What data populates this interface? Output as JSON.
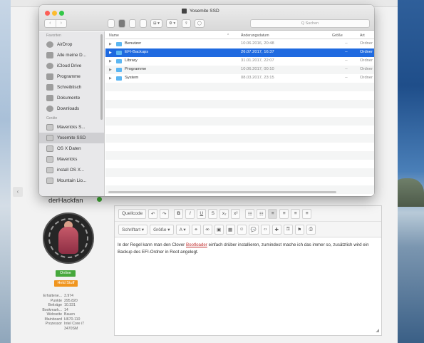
{
  "finder": {
    "title": "Yosemite SSD",
    "search_placeholder": "Q Suchen",
    "nav_back": "‹",
    "nav_forward": "›",
    "arrange_label": "⊞ ▾",
    "action_label": "⚙ ▾",
    "share_label": "⇪",
    "tag_label": "◯",
    "columns": {
      "name": "Name",
      "date": "Änderungsdatum",
      "size": "Größe",
      "kind": "Art"
    },
    "rows": [
      {
        "name": "Benutzer",
        "date": "10.06.2016, 20:48",
        "size": "--",
        "kind": "Ordner"
      },
      {
        "name": "EFI-Backups",
        "date": "26.07.2017, 16:37",
        "size": "--",
        "kind": "Ordner"
      },
      {
        "name": "Library",
        "date": "31.01.2017, 22:07",
        "size": "--",
        "kind": "Ordner"
      },
      {
        "name": "Programme",
        "date": "10.06.2017, 00:10",
        "size": "--",
        "kind": "Ordner"
      },
      {
        "name": "System",
        "date": "08.03.2017, 23:15",
        "size": "--",
        "kind": "Ordner"
      }
    ],
    "sidebar": {
      "favorites_heading": "Favoriten",
      "favorites": [
        "AirDrop",
        "Alle meine D...",
        "iCloud Drive",
        "Programme",
        "Schreibtisch",
        "Dokumente",
        "Downloads"
      ],
      "devices_heading": "Geräte",
      "devices": [
        "Mavericks S...",
        "Yosemite SSD",
        "OS X Daten",
        "Mavericks",
        "install OS X...",
        "Mountain Lio..."
      ]
    }
  },
  "forum": {
    "username": "derHackfan",
    "badge_online": "Online",
    "badge_rank": "Held Stuff",
    "stats": [
      {
        "k": "Erhaltene...",
        "v": "3.974"
      },
      {
        "k": "Punkte",
        "v": "295.820"
      },
      {
        "k": "Beiträge",
        "v": "10.331"
      },
      {
        "k": "Bookmark...",
        "v": "14"
      },
      {
        "k": "Webseite",
        "v": "Bauen"
      },
      {
        "k": "Mainboard",
        "v": "H670-110"
      },
      {
        "k": "Prozessor",
        "v": "Intel Core i7"
      },
      {
        "k": "",
        "v": "3470SM"
      }
    ],
    "toolbar1": [
      "Quellcode",
      "↶",
      "↷",
      "B",
      "I",
      "U",
      "S",
      "x₂",
      "x²",
      "☷",
      "☷",
      "≡",
      "≡",
      "≡",
      "≡"
    ],
    "toolbar2": [
      "Schriftart ▾",
      "Größe ▾",
      "A ▾",
      "⚭",
      "⚮",
      "▣",
      "▦",
      "☺",
      "💬",
      "‹›",
      "✚",
      "⚿",
      "⚑",
      "⎙"
    ],
    "body_before": "In der Regel kann man den Clover ",
    "body_link": "Bootloader",
    "body_after": " einfach drüber installieren, zumindest mache ich das immer so, zusätzlich wird ein Backup des EFI-Ordner in Root angelegt."
  }
}
